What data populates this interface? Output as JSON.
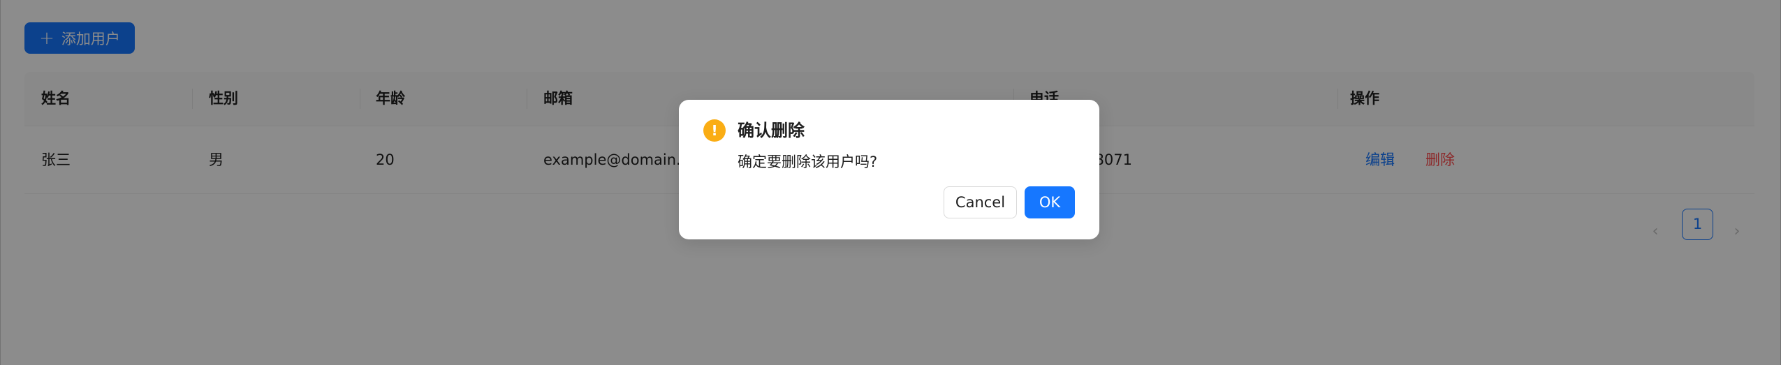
{
  "toolbar": {
    "add_user_label": "添加用户",
    "add_icon": "plus-icon"
  },
  "table": {
    "columns": [
      "姓名",
      "性别",
      "年龄",
      "邮箱",
      "电话",
      "操作"
    ],
    "rows": [
      {
        "name": "张三",
        "gender": "男",
        "age": "20",
        "email": "example@domain.com",
        "phone": "13800138071",
        "edit_label": "编辑",
        "delete_label": "删除"
      }
    ]
  },
  "pagination": {
    "current_page": "1",
    "prev_icon": "chevron-left-icon",
    "next_icon": "chevron-right-icon"
  },
  "modal": {
    "icon": "exclamation-circle-icon",
    "icon_glyph": "!",
    "title": "确认删除",
    "content": "确定要删除该用户吗?",
    "cancel_label": "Cancel",
    "ok_label": "OK"
  },
  "colors": {
    "primary": "#1677ff",
    "danger": "#ff4d4f",
    "warning": "#faad14"
  }
}
